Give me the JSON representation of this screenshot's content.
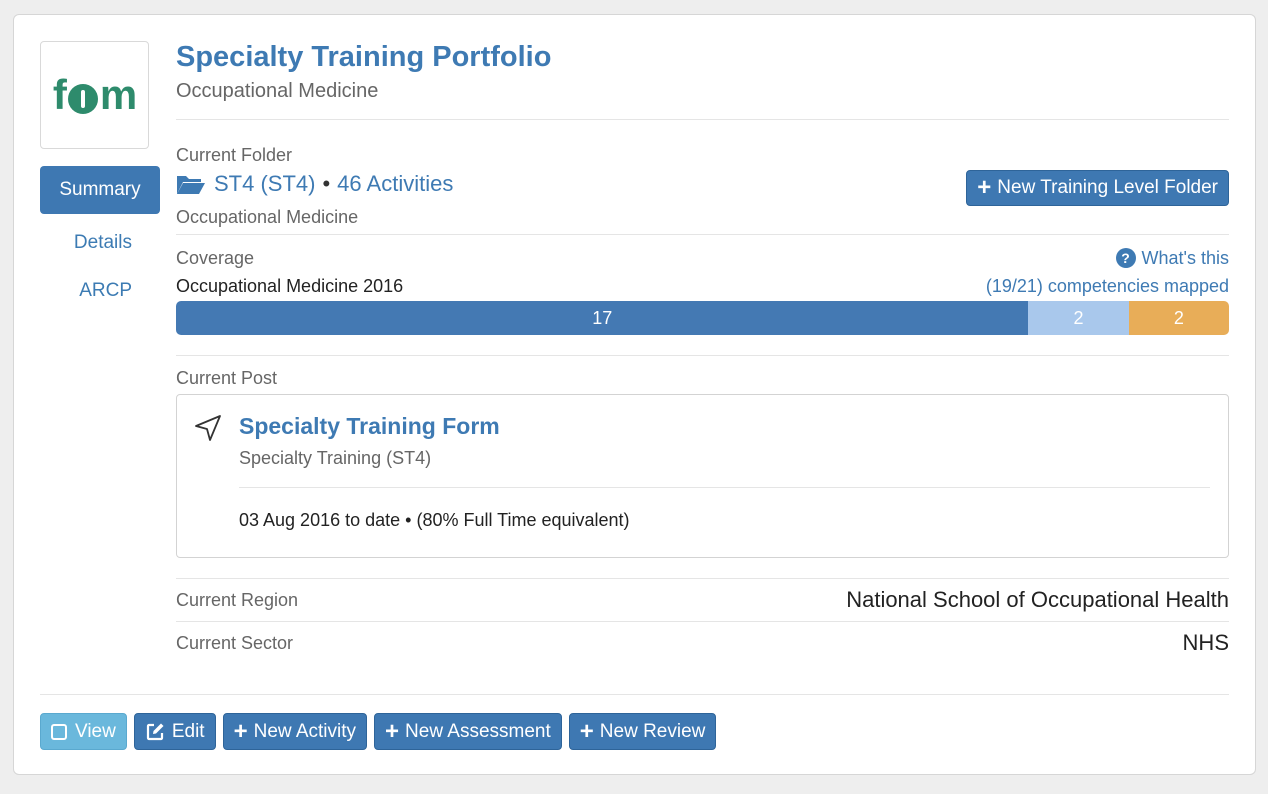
{
  "logo": {
    "text_left": "f",
    "text_right": "m",
    "icon": "fom-logo-icon"
  },
  "nav": {
    "items": [
      {
        "label": "Summary",
        "active": true
      },
      {
        "label": "Details",
        "active": false
      },
      {
        "label": "ARCP",
        "active": false
      }
    ]
  },
  "header": {
    "title": "Specialty Training Portfolio",
    "subtitle": "Occupational Medicine"
  },
  "folder": {
    "label": "Current Folder",
    "name": "ST4 (ST4)",
    "separator": "•",
    "activities": "46 Activities",
    "subtitle": "Occupational Medicine",
    "new_button": "New Training Level Folder"
  },
  "coverage": {
    "label": "Coverage",
    "whats_this": "What's this",
    "framework": "Occupational Medicine 2016",
    "mapped": "(19/21) competencies mapped",
    "segments": [
      {
        "value": 17,
        "label": "17",
        "color": "#4479b3"
      },
      {
        "value": 2,
        "label": "2",
        "color": "#a9c8ec"
      },
      {
        "value": 2,
        "label": "2",
        "color": "#e8ad58"
      }
    ]
  },
  "post": {
    "label": "Current Post",
    "title": "Specialty Training Form",
    "subtitle": "Specialty Training (ST4)",
    "dates": "03 Aug 2016 to date • (80% Full Time equivalent)"
  },
  "region": {
    "label": "Current Region",
    "value": "National School of Occupational Health"
  },
  "sector": {
    "label": "Current Sector",
    "value": "NHS"
  },
  "footer": {
    "view": "View",
    "edit": "Edit",
    "new_activity": "New Activity",
    "new_assessment": "New Assessment",
    "new_review": "New Review"
  }
}
